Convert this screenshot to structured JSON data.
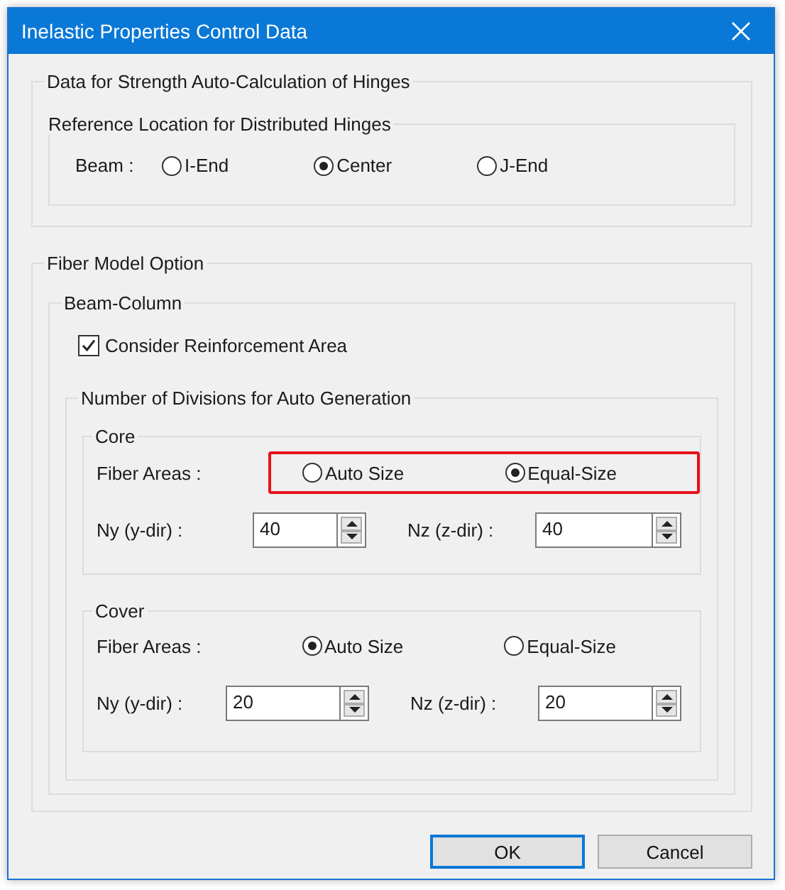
{
  "window": {
    "title": "Inelastic Properties Control Data"
  },
  "strength_group": {
    "title": "Data for Strength Auto-Calculation of Hinges",
    "reference": {
      "title": "Reference Location for Distributed Hinges",
      "label": "Beam :",
      "options": [
        {
          "label": "I-End",
          "selected": false
        },
        {
          "label": "Center",
          "selected": true
        },
        {
          "label": "J-End",
          "selected": false
        }
      ]
    }
  },
  "fiber_group": {
    "title": "Fiber Model Option",
    "beam_column": {
      "title": "Beam-Column",
      "reinforcement": {
        "label": "Consider Reinforcement Area",
        "checked": true
      },
      "divisions": {
        "title": "Number of Divisions for Auto Generation",
        "sections": [
          {
            "title": "Core",
            "fiber_label": "Fiber Areas :",
            "highlighted": true,
            "options": [
              {
                "label": "Auto Size",
                "selected": false
              },
              {
                "label": "Equal-Size",
                "selected": true
              }
            ],
            "fields": [
              {
                "label": "Ny (y-dir) :",
                "value": "40"
              },
              {
                "label": "Nz (z-dir) :",
                "value": "40"
              }
            ]
          },
          {
            "title": "Cover",
            "fiber_label": "Fiber Areas :",
            "highlighted": false,
            "options": [
              {
                "label": "Auto Size",
                "selected": true
              },
              {
                "label": "Equal-Size",
                "selected": false
              }
            ],
            "fields": [
              {
                "label": "Ny (y-dir) :",
                "value": "20"
              },
              {
                "label": "Nz (z-dir) :",
                "value": "20"
              }
            ]
          }
        ]
      }
    }
  },
  "buttons": [
    {
      "label": "OK",
      "default": true
    },
    {
      "label": "Cancel",
      "default": false
    }
  ]
}
